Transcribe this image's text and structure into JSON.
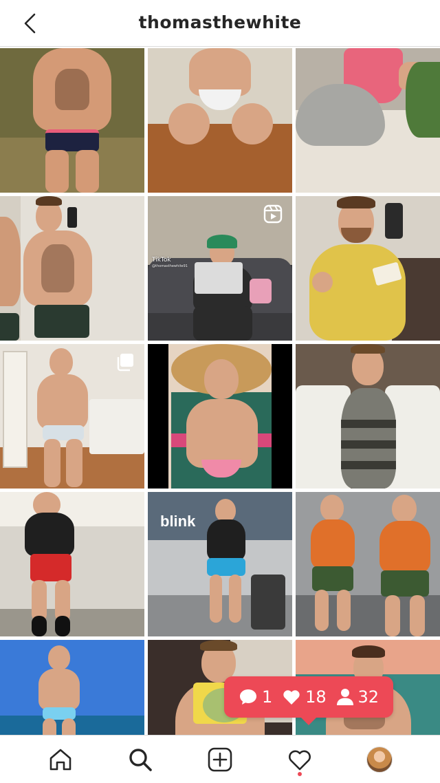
{
  "header": {
    "title": "thomasthewhite",
    "back_icon": "chevron-left-icon"
  },
  "grid": {
    "tiles": [
      {
        "id": "post-1",
        "type": "photo"
      },
      {
        "id": "post-2",
        "type": "photo"
      },
      {
        "id": "post-3",
        "type": "photo"
      },
      {
        "id": "post-4",
        "type": "photo"
      },
      {
        "id": "post-5",
        "type": "reel",
        "overlay_brand": "TikTok",
        "overlay_handle": "@thomasthewhite91",
        "badge_icon": "reels-icon"
      },
      {
        "id": "post-6",
        "type": "photo"
      },
      {
        "id": "post-7",
        "type": "carousel",
        "badge_icon": "carousel-icon"
      },
      {
        "id": "post-8",
        "type": "photo"
      },
      {
        "id": "post-9",
        "type": "photo"
      },
      {
        "id": "post-10",
        "type": "photo"
      },
      {
        "id": "post-11",
        "type": "photo",
        "sign_text": "blink"
      },
      {
        "id": "post-12",
        "type": "photo"
      },
      {
        "id": "post-13",
        "type": "photo"
      },
      {
        "id": "post-14",
        "type": "photo"
      },
      {
        "id": "post-15",
        "type": "photo"
      }
    ]
  },
  "notification": {
    "comments": "1",
    "likes": "18",
    "followers": "32",
    "color": "#ed4956"
  },
  "tabbar": {
    "items": [
      {
        "name": "home",
        "icon": "home-icon"
      },
      {
        "name": "search",
        "icon": "search-icon",
        "active": true
      },
      {
        "name": "new-post",
        "icon": "plus-square-icon"
      },
      {
        "name": "activity",
        "icon": "heart-icon",
        "has_dot": true
      },
      {
        "name": "profile",
        "icon": "avatar"
      }
    ]
  },
  "colors": {
    "accent": "#ed4956",
    "text": "#262626",
    "border": "#dbdbdb"
  }
}
